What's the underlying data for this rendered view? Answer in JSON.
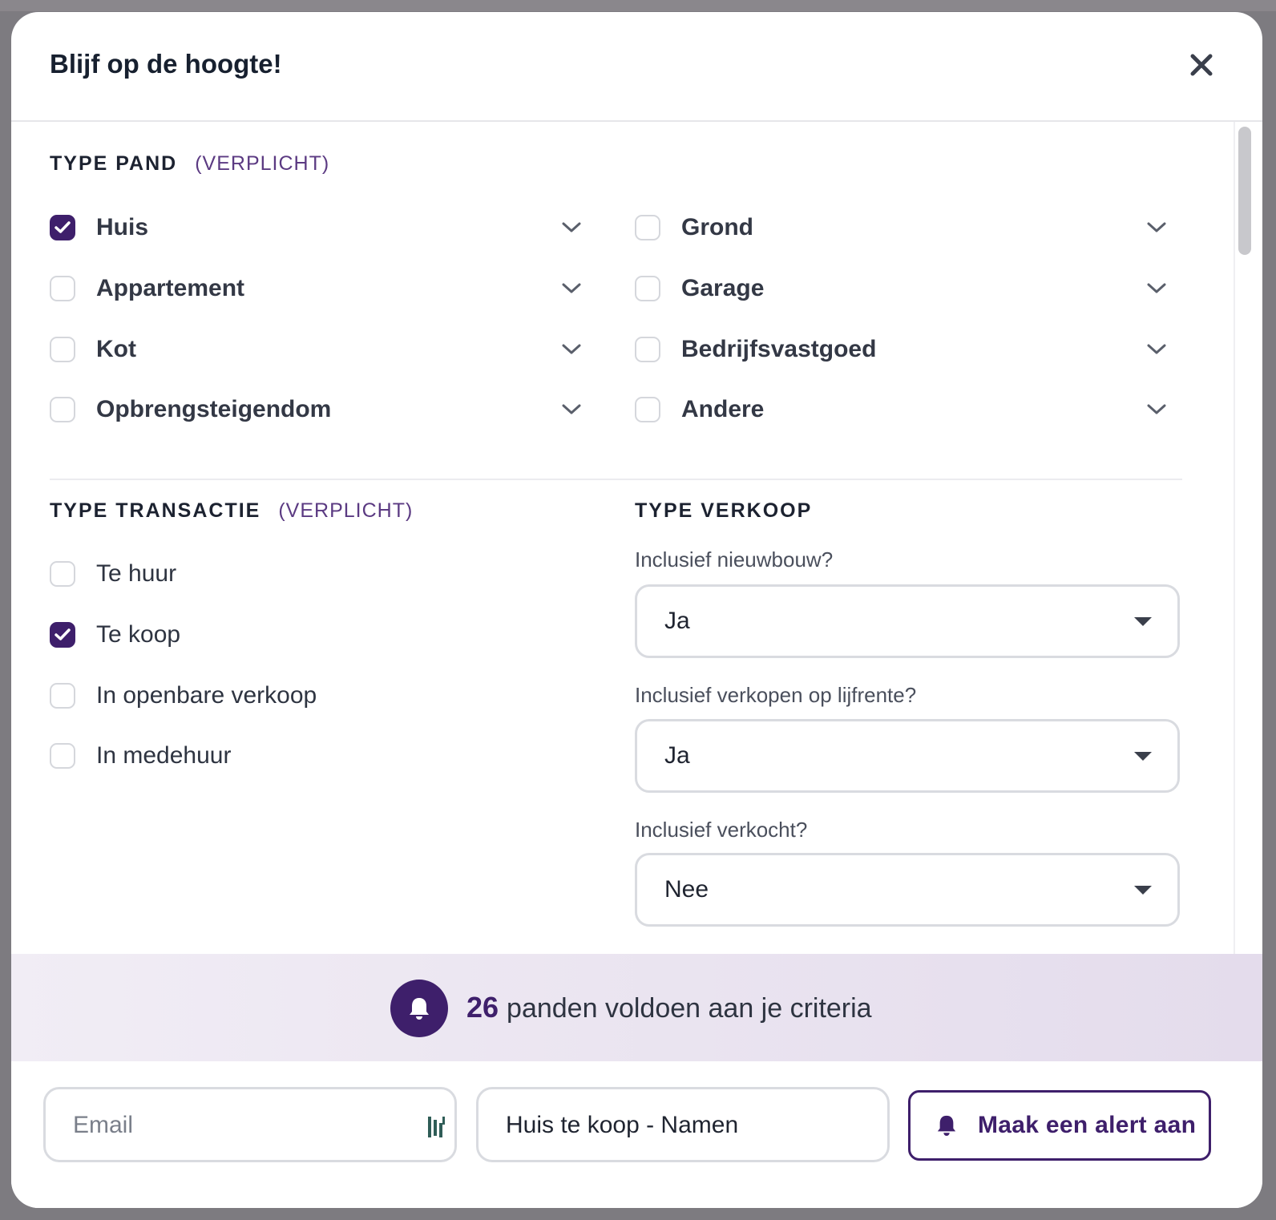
{
  "modal": {
    "title": "Blijf op de hoogte!"
  },
  "type_pand": {
    "title": "TYPE PAND",
    "required": "(VERPLICHT)",
    "options": [
      {
        "label": "Huis",
        "checked": true
      },
      {
        "label": "Appartement",
        "checked": false
      },
      {
        "label": "Kot",
        "checked": false
      },
      {
        "label": "Opbrengsteigendom",
        "checked": false
      },
      {
        "label": "Grond",
        "checked": false
      },
      {
        "label": "Garage",
        "checked": false
      },
      {
        "label": "Bedrijfsvastgoed",
        "checked": false
      },
      {
        "label": "Andere",
        "checked": false
      }
    ]
  },
  "type_transactie": {
    "title": "TYPE TRANSACTIE",
    "required": "(VERPLICHT)",
    "options": [
      {
        "label": "Te huur",
        "checked": false
      },
      {
        "label": "Te koop",
        "checked": true
      },
      {
        "label": "In openbare verkoop",
        "checked": false
      },
      {
        "label": "In medehuur",
        "checked": false
      }
    ]
  },
  "type_verkoop": {
    "title": "TYPE VERKOOP",
    "fields": [
      {
        "label": "Inclusief nieuwbouw?",
        "value": "Ja"
      },
      {
        "label": "Inclusief verkopen op lijfrente?",
        "value": "Ja"
      },
      {
        "label": "Inclusief verkocht?",
        "value": "Nee"
      }
    ]
  },
  "results": {
    "count": "26",
    "text": "panden voldoen aan je criteria"
  },
  "footer": {
    "email_placeholder": "Email",
    "alert_name_value": "Huis te koop - Namen",
    "create_alert_label": "Maak een alert aan"
  },
  "colors": {
    "accent": "#3e1f6b",
    "required_text": "#5b3a82",
    "results_bar_start": "#f1edf5",
    "results_bar_end": "#e4dcec"
  },
  "icons": [
    "close-icon",
    "checkmark-icon",
    "chevron-down-icon",
    "caret-down-icon",
    "bell-icon",
    "password-manager-icon"
  ]
}
